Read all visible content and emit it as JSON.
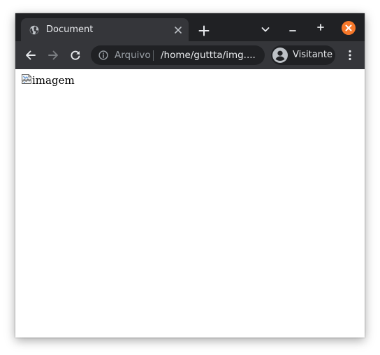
{
  "window": {
    "tab": {
      "title": "Document",
      "favicon": "globe-icon"
    },
    "controls": [
      "chevron-down-icon",
      "minimize-icon",
      "maximize-icon",
      "close-icon"
    ],
    "close_button_color": "#f7782a"
  },
  "toolbar": {
    "nav_icons": [
      "back-arrow-icon",
      "forward-arrow-icon",
      "reload-icon"
    ],
    "security_label": "Arquivo",
    "url": "/home/guttta/img....",
    "profile_name": "Visitante",
    "menu_icon": "more-vertical-icon"
  },
  "page": {
    "image_alt": "imagem",
    "image_icon": "broken-image-icon"
  },
  "colors": {
    "tabbar": "#202124",
    "toolbar": "#35363a",
    "text": "#e8eaed",
    "muted": "#9aa0a6"
  }
}
